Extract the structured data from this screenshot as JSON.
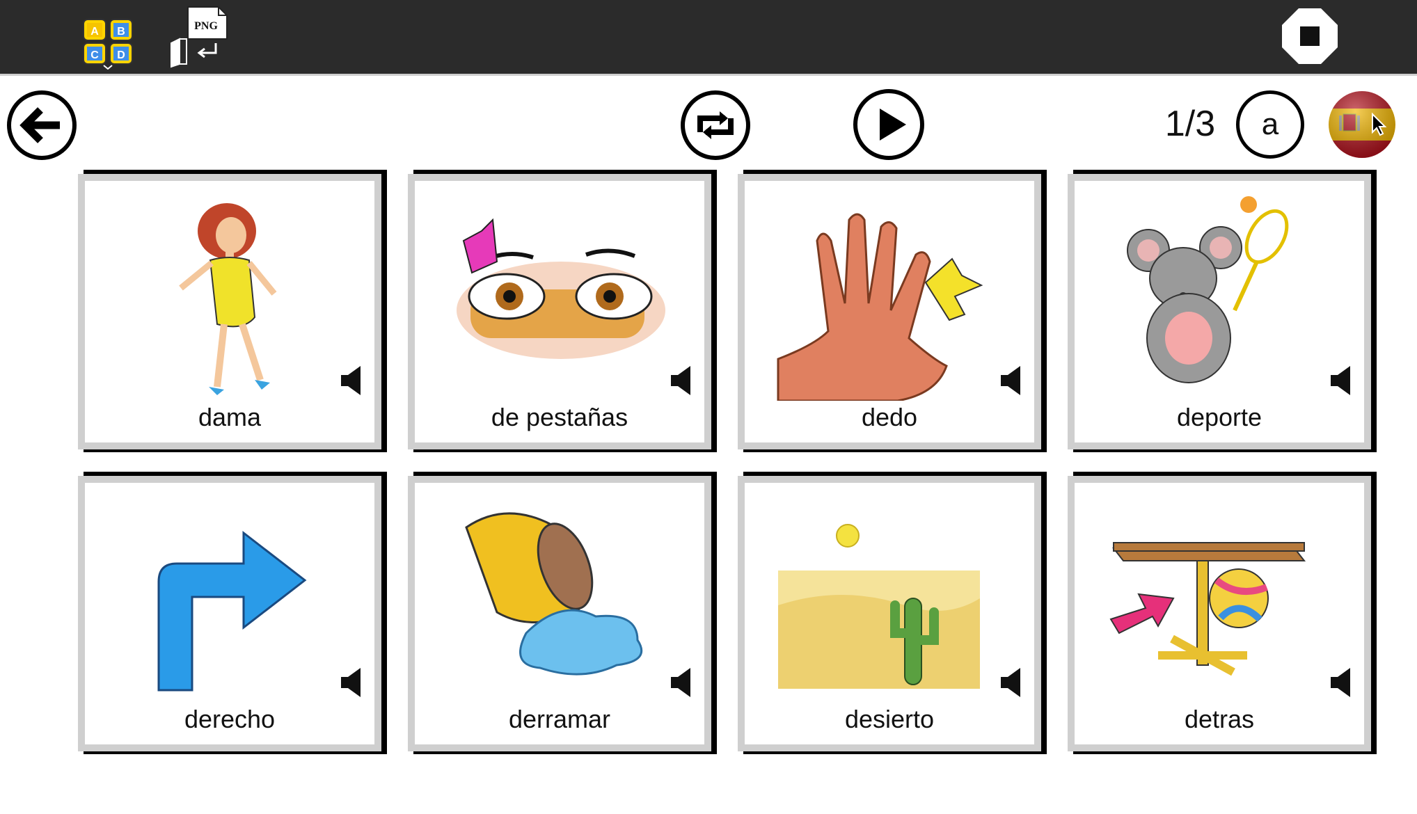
{
  "toolbar": {
    "abc_icon": "abc-blocks-icon",
    "abc_letters": [
      "A",
      "B",
      "C",
      "D"
    ],
    "png_icon": "png-export-icon",
    "png_label": "PNG",
    "stop_icon": "stop-icon"
  },
  "controls": {
    "back_icon": "back-arrow-icon",
    "repeat_icon": "repeat-icon",
    "play_icon": "play-icon",
    "page_counter": "1/3",
    "letter_button": "a",
    "language_icon": "spain-flag-icon"
  },
  "cards": [
    {
      "label": "dama",
      "icon": "woman-icon"
    },
    {
      "label": "de pestañas",
      "icon": "eyelashes-icon"
    },
    {
      "label": "dedo",
      "icon": "finger-icon"
    },
    {
      "label": "deporte",
      "icon": "mouse-tennis-icon"
    },
    {
      "label": "derecho",
      "icon": "right-arrow-icon"
    },
    {
      "label": "derramar",
      "icon": "spilled-bucket-icon"
    },
    {
      "label": "desierto",
      "icon": "desert-cactus-icon"
    },
    {
      "label": "detras",
      "icon": "ball-behind-table-icon"
    }
  ],
  "colors": {
    "topbar": "#2b2b2b",
    "card_frame": "#cfcfcf",
    "card_shadow": "#000000",
    "flag_red": "#c60b1e",
    "flag_yellow": "#ffc400"
  }
}
